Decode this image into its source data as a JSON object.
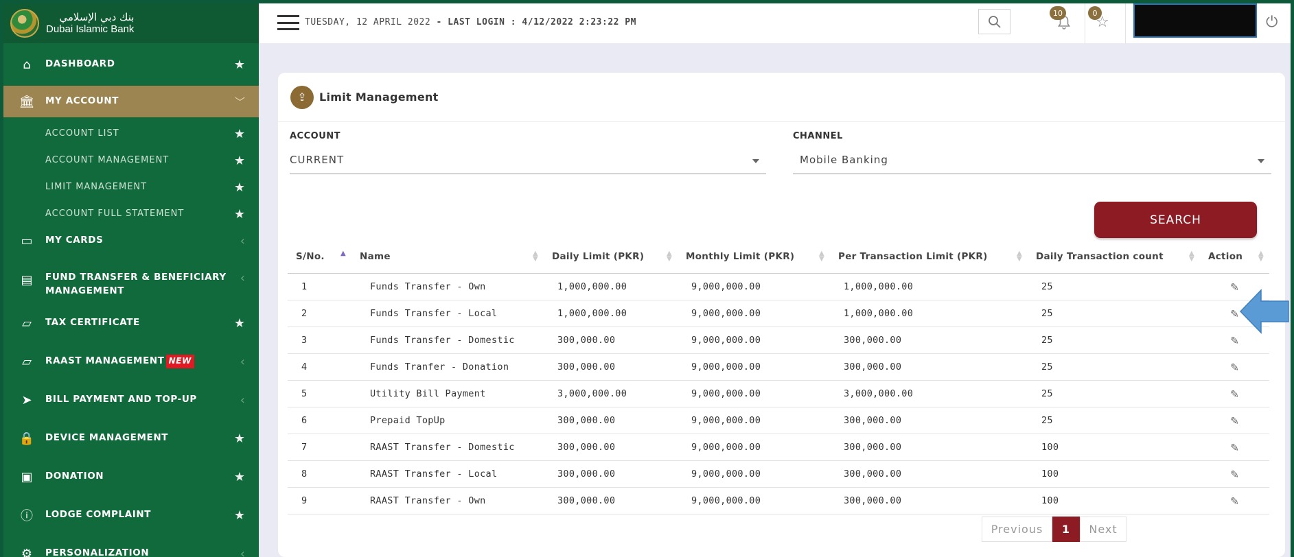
{
  "brand": {
    "name_ar": "بنك دبي الإسلامي",
    "name_en": "Dubai Islamic Bank"
  },
  "topbar": {
    "date": "TUESDAY, 12 APRIL 2022",
    "last_login_label": "- LAST LOGIN : ",
    "last_login_value": "4/12/2022 2:23:22 PM",
    "notifications_count": "10",
    "favorites_count": "0"
  },
  "sidebar": {
    "items": [
      {
        "label": "DASHBOARD",
        "icon": "home-icon",
        "right": "star"
      },
      {
        "label": "MY ACCOUNT",
        "icon": "bank-icon",
        "right": "chevron-down",
        "active": true
      },
      {
        "label": "ACCOUNT LIST",
        "right": "star",
        "sub": true
      },
      {
        "label": "ACCOUNT MANAGEMENT",
        "right": "star",
        "sub": true
      },
      {
        "label": "LIMIT MANAGEMENT",
        "right": "star",
        "sub": true
      },
      {
        "label": "ACCOUNT FULL STATEMENT",
        "right": "star",
        "sub": true
      },
      {
        "label": "MY CARDS",
        "icon": "card-icon",
        "right": "chevron-left"
      },
      {
        "label": "FUND TRANSFER & BENEFICIARY",
        "label2": "MANAGEMENT",
        "icon": "book-icon",
        "right": "chevron-left"
      },
      {
        "label": "TAX CERTIFICATE",
        "icon": "wallet-icon",
        "right": "star"
      },
      {
        "label": "RAAST MANAGEMENT",
        "badge": "NEW",
        "icon": "wallet-icon",
        "right": "chevron-left"
      },
      {
        "label": "BILL PAYMENT AND TOP-UP",
        "icon": "send-icon",
        "right": "chevron-left"
      },
      {
        "label": "DEVICE MANAGEMENT",
        "icon": "lock-icon",
        "right": "star"
      },
      {
        "label": "DONATION",
        "icon": "money-icon",
        "right": "star"
      },
      {
        "label": "LODGE COMPLAINT",
        "icon": "alert-icon",
        "right": "star"
      },
      {
        "label": "PERSONALIZATION",
        "icon": "gear-icon",
        "right": "chevron-left"
      }
    ]
  },
  "card": {
    "title": "Limit Management",
    "account_label": "ACCOUNT",
    "account_value": "CURRENT",
    "channel_label": "CHANNEL",
    "channel_value": "Mobile Banking",
    "search_label": "SEARCH"
  },
  "table": {
    "headers": [
      "S/No.",
      "Name",
      "Daily Limit (PKR)",
      "Monthly Limit (PKR)",
      "Per Transaction Limit (PKR)",
      "Daily Transaction count",
      "Action"
    ],
    "rows": [
      [
        "1",
        "Funds Transfer - Own",
        "1,000,000.00",
        "9,000,000.00",
        "1,000,000.00",
        "25"
      ],
      [
        "2",
        "Funds Transfer - Local",
        "1,000,000.00",
        "9,000,000.00",
        "1,000,000.00",
        "25"
      ],
      [
        "3",
        "Funds Transfer - Domestic",
        "300,000.00",
        "9,000,000.00",
        "300,000.00",
        "25"
      ],
      [
        "4",
        "Funds Tranfer - Donation",
        "300,000.00",
        "9,000,000.00",
        "300,000.00",
        "25"
      ],
      [
        "5",
        "Utility Bill Payment",
        "3,000,000.00",
        "9,000,000.00",
        "3,000,000.00",
        "25"
      ],
      [
        "6",
        "Prepaid TopUp",
        "300,000.00",
        "9,000,000.00",
        "300,000.00",
        "25"
      ],
      [
        "7",
        "RAAST Transfer - Domestic",
        "300,000.00",
        "9,000,000.00",
        "300,000.00",
        "100"
      ],
      [
        "8",
        "RAAST Transfer - Local",
        "300,000.00",
        "9,000,000.00",
        "300,000.00",
        "100"
      ],
      [
        "9",
        "RAAST Transfer - Own",
        "300,000.00",
        "9,000,000.00",
        "300,000.00",
        "100"
      ]
    ]
  },
  "pager": {
    "prev": "Previous",
    "current": "1",
    "next": "Next"
  },
  "colors": {
    "sidebar": "#116a3b",
    "active": "#9c8550",
    "accent": "#8d1b23",
    "pointer": "#5b9bd5"
  }
}
